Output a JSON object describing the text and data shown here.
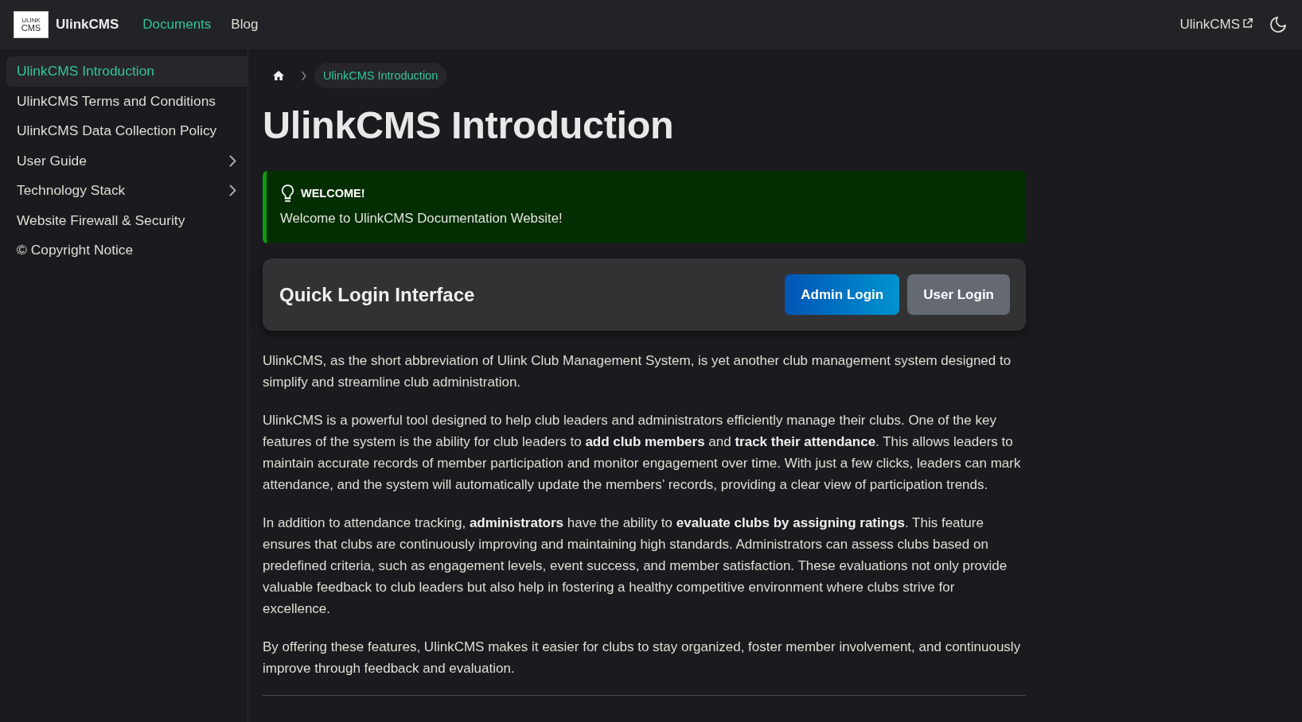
{
  "header": {
    "logo": {
      "line_1": "ULINK",
      "line_2": "CMS"
    },
    "site_name": "UlinkCMS",
    "nav": [
      {
        "label": "Documents",
        "selected": true
      },
      {
        "label": "Blog",
        "selected": false
      }
    ],
    "external_link": {
      "label": "UlinkCMS",
      "external": true
    }
  },
  "sidebar": {
    "items": [
      {
        "label": "UlinkCMS Introduction",
        "kind": "link",
        "selected": true
      },
      {
        "label": "UlinkCMS Terms and Conditions",
        "kind": "link",
        "selected": false
      },
      {
        "label": "UlinkCMS Data Collection Policy",
        "kind": "link",
        "selected": false
      },
      {
        "label": "User Guide",
        "kind": "group",
        "selected": false,
        "expanded": false
      },
      {
        "label": "Technology Stack",
        "kind": "group",
        "selected": false,
        "expanded": false
      },
      {
        "label": "Website Firewall & Security",
        "kind": "link",
        "selected": false
      },
      {
        "label": "© Copyright Notice",
        "kind": "link",
        "selected": false
      }
    ]
  },
  "breadcrumb": {
    "current": "UlinkCMS Introduction"
  },
  "page_title": "UlinkCMS Introduction",
  "callout": {
    "kind": "tip",
    "title": "WELCOME!",
    "text": "Welcome to UlinkCMS Documentation Website!"
  },
  "login_card": {
    "title": "Quick Login Interface",
    "buttons": [
      {
        "label": "Admin Login",
        "kind": "primary"
      },
      {
        "label": "User Login",
        "kind": "secondary"
      }
    ]
  },
  "paragraphs": [
    "UlinkCMS, as the short abbreviation of Ulink Club Management System, is yet another club management system designed to simplify and streamline club administration.",
    "UlinkCMS is a powerful tool designed to help club leaders and administrators efficiently manage their clubs. One of the key features of the system is the ability for club leaders to **add club members** and **track their attendance**. This allows leaders to maintain accurate records of member participation and monitor engagement over time. With just a few clicks, leaders can mark attendance, and the system will automatically update the members’ records, providing a clear view of participation trends.",
    "In addition to attendance tracking, **administrators** have the ability to **evaluate clubs by assigning ratings**. This feature ensures that clubs are continuously improving and maintaining high standards. Administrators can assess clubs based on predefined criteria, such as engagement levels, event success, and member satisfaction. These evaluations not only provide valuable feedback to club leaders but also help in fostering a healthy competitive environment where clubs strive for excellence.",
    "By offering these features, UlinkCMS makes it easier for clubs to stay organized, foster member involvement, and continuously improve through feedback and evaluation."
  ]
}
